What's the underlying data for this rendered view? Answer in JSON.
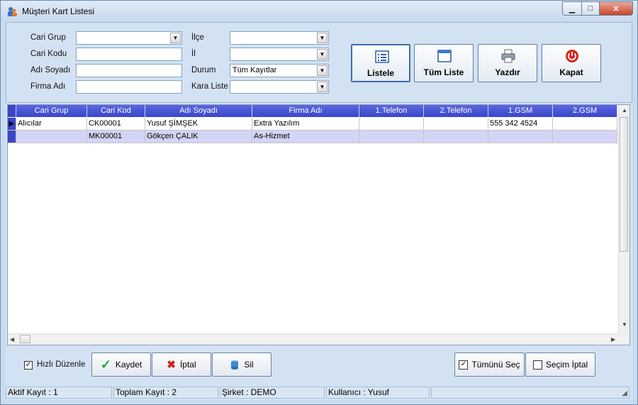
{
  "window": {
    "title": "Müşteri Kart Listesi"
  },
  "filters": {
    "cari_grup": {
      "label": "Cari Grup",
      "value": ""
    },
    "cari_kodu": {
      "label": "Cari Kodu",
      "value": ""
    },
    "adi_soyadi": {
      "label": "Adı Soyadı",
      "value": ""
    },
    "firma_adi": {
      "label": "Firma Adı",
      "value": ""
    },
    "ilce": {
      "label": "İlçe",
      "value": ""
    },
    "il": {
      "label": "İl",
      "value": ""
    },
    "durum": {
      "label": "Durum",
      "value": "Tüm Kayıtlar"
    },
    "kara_liste": {
      "label": "Kara Liste",
      "value": ""
    }
  },
  "actions": {
    "listele": "Listele",
    "tum_liste": "Tüm Liste",
    "yazdir": "Yazdır",
    "kapat": "Kapat"
  },
  "grid": {
    "columns": [
      "Cari Grup",
      "Cari Kod",
      "Adı Soyadı",
      "Firma Adı",
      "1.Telefon",
      "2.Telefon",
      "1.GSM",
      "2.GSM"
    ],
    "rows": [
      {
        "cari_grup": "Alıcılar",
        "cari_kod": "CK00001",
        "adi_soyadi": "Yusuf ŞİMŞEK",
        "firma_adi": "Extra Yazılım",
        "tel1": "",
        "tel2": "",
        "gsm1": "555 342 4524",
        "gsm2": ""
      },
      {
        "cari_grup": "",
        "cari_kod": "MK00001",
        "adi_soyadi": "Gökçen ÇALIK",
        "firma_adi": "As-Hizmet",
        "tel1": "",
        "tel2": "",
        "gsm1": "",
        "gsm2": ""
      }
    ]
  },
  "bottom": {
    "hizli_duzenle": "Hızlı Düzenle",
    "kaydet": "Kaydet",
    "iptal": "İptal",
    "sil": "Sil",
    "tumunu_sec": "Tümünü Seç",
    "secim_iptal": "Seçim İptal"
  },
  "status": {
    "aktif_kayit": "Aktif Kayıt : 1",
    "toplam_kayit": "Toplam Kayıt : 2",
    "sirket": "Şirket : DEMO",
    "kullanici": "Kullanıcı : Yusuf"
  },
  "colors": {
    "header_bg": "#3f4bcf",
    "selected_row": "#d4d4f7",
    "accent": "#3f6fa8"
  }
}
